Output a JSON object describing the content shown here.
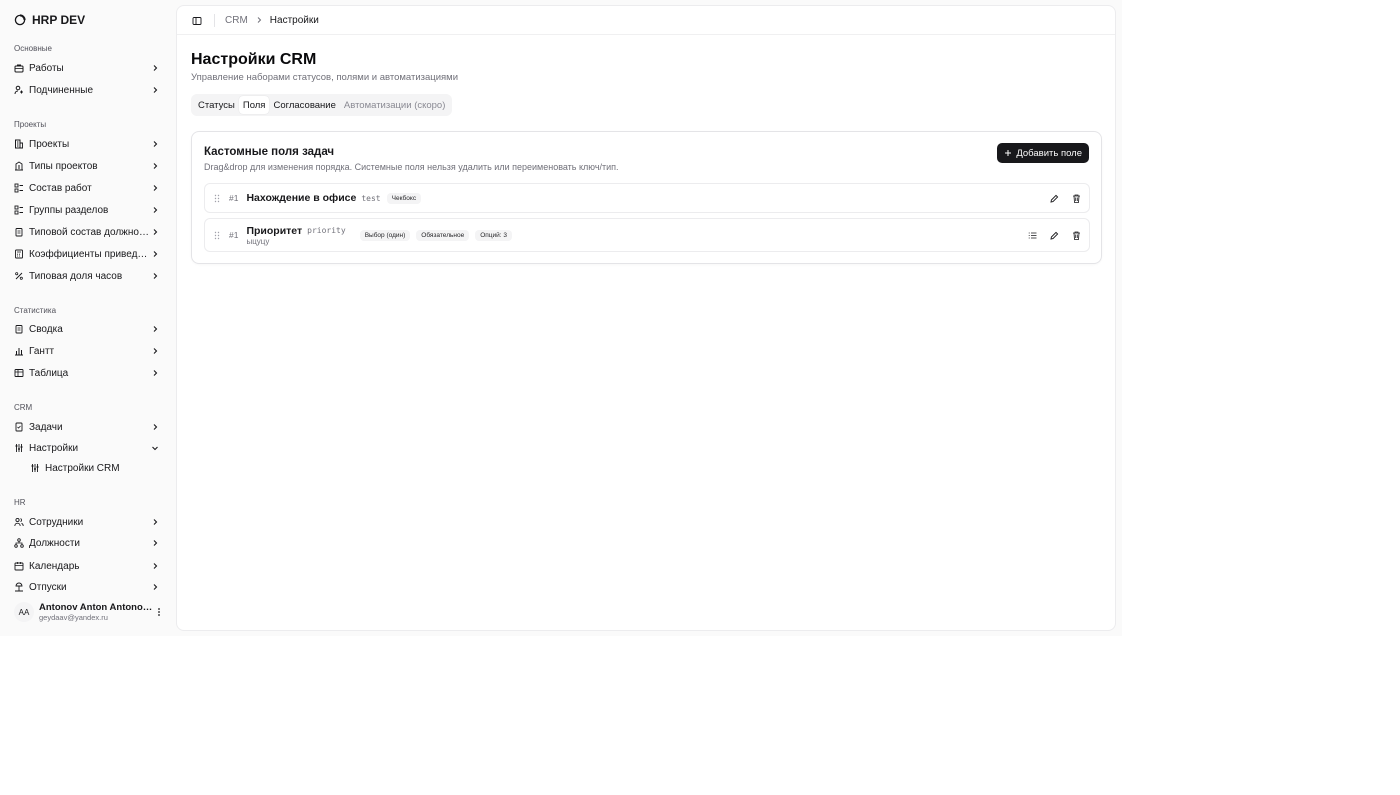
{
  "app": {
    "brand": "HRP DEV"
  },
  "sidebar": {
    "groups": [
      {
        "label": "Основные",
        "items": [
          {
            "label": "Работы",
            "icon": "briefcase-icon"
          },
          {
            "label": "Подчиненные",
            "icon": "user-tree-icon"
          }
        ]
      },
      {
        "label": "Проекты",
        "items": [
          {
            "label": "Проекты",
            "icon": "building-icon"
          },
          {
            "label": "Типы проектов",
            "icon": "building-icon"
          },
          {
            "label": "Состав работ",
            "icon": "list-tree-icon"
          },
          {
            "label": "Группы разделов",
            "icon": "list-tree-icon"
          },
          {
            "label": "Типовой состав должност…",
            "icon": "clipboard-icon"
          },
          {
            "label": "Коэффициенты приведени…",
            "icon": "calculator-icon"
          },
          {
            "label": "Типовая доля часов",
            "icon": "percent-icon"
          }
        ]
      },
      {
        "label": "Статистика",
        "items": [
          {
            "label": "Сводка",
            "icon": "clipboard-icon"
          },
          {
            "label": "Гантт",
            "icon": "chart-icon"
          },
          {
            "label": "Таблица",
            "icon": "table-icon"
          }
        ]
      },
      {
        "label": "CRM",
        "items": [
          {
            "label": "Задачи",
            "icon": "task-icon"
          },
          {
            "label": "Настройки",
            "icon": "sliders-icon",
            "expanded": true,
            "children": [
              {
                "label": "Настройки CRM",
                "icon": "sliders-icon"
              }
            ]
          }
        ]
      },
      {
        "label": "HR",
        "items": [
          {
            "label": "Сотрудники",
            "icon": "users-icon"
          },
          {
            "label": "Должности",
            "icon": "network-icon"
          },
          {
            "label": "Календарь",
            "icon": "calendar-icon"
          },
          {
            "label": "Отпуски",
            "icon": "vacation-icon"
          }
        ]
      }
    ],
    "user": {
      "initials": "AA",
      "name": "Antonov Anton Antonovi…",
      "email": "geydaav@yandex.ru"
    }
  },
  "breadcrumb": {
    "parent": "CRM",
    "current": "Настройки"
  },
  "page": {
    "title": "Настройки CRM",
    "subtitle": "Управление наборами статусов, полями и автоматизациями",
    "tabs": [
      {
        "label": "Статусы",
        "state": "normal"
      },
      {
        "label": "Поля",
        "state": "active"
      },
      {
        "label": "Согласование",
        "state": "normal"
      },
      {
        "label": "Автоматизации (скоро)",
        "state": "disabled"
      }
    ]
  },
  "card": {
    "title": "Кастомные поля задач",
    "description": "Drag&drop для изменения порядка. Системные поля нельзя удалить или переименовать ключ/тип.",
    "add_label": "Добавить поле",
    "fields": [
      {
        "order": "#1",
        "name": "Нахождение в офисе",
        "key": "test",
        "description": "",
        "badges": [
          "Чекбокс"
        ],
        "has_options_button": false
      },
      {
        "order": "#1",
        "name": "Приоритет",
        "key": "priority",
        "description": "ыцуцу",
        "badges": [
          "Выбор (один)",
          "Обязательное",
          "Опций: 3"
        ],
        "has_options_button": true
      }
    ]
  },
  "colors": {
    "primary": "#18181b",
    "muted": "#71717a",
    "background": "#fafafa",
    "border": "#e4e4e7"
  }
}
